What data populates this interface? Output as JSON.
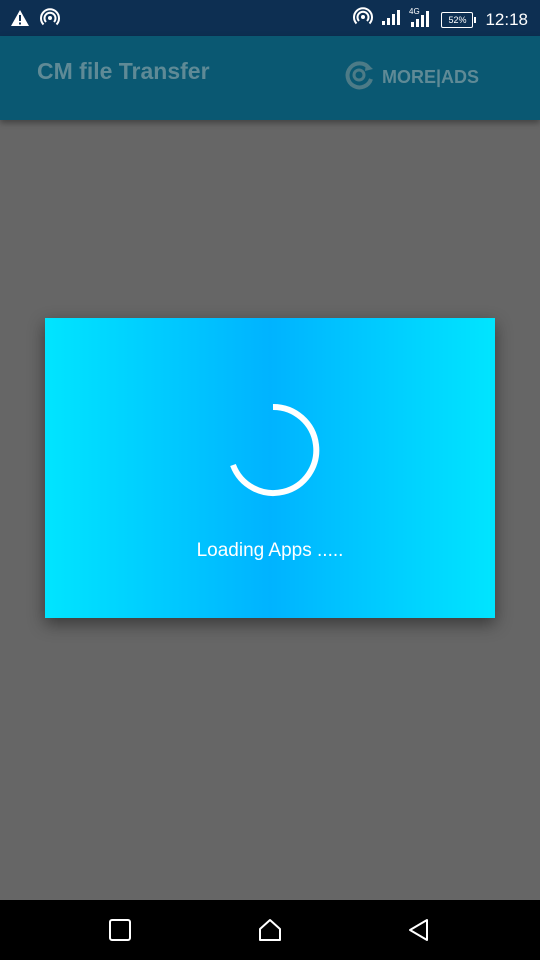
{
  "status_bar": {
    "time": "12:18",
    "battery": "52%",
    "network": "4G",
    "left_icons": [
      "warning-icon",
      "hotspot-icon"
    ],
    "right_icons": [
      "hotspot-icon",
      "signal-icon",
      "signal-4g-icon",
      "battery-icon"
    ]
  },
  "app_bar": {
    "title": "CM file Transfer",
    "more_ads_label": "MORE|ADS",
    "more_ads_icon": "refresh-c-icon"
  },
  "dialog": {
    "message": "Loading Apps .....",
    "spinner_icon": "loading-spinner-icon"
  },
  "nav_bar": {
    "buttons": [
      "recent-apps-icon",
      "home-icon",
      "back-icon"
    ]
  },
  "colors": {
    "status_bar": "#0d2f52",
    "app_bar": "#0a5872",
    "scrim": "#666666",
    "dialog_edge": "#00e5ff",
    "dialog_center": "#00b3ff",
    "text_on_dialog": "#ffffff"
  }
}
